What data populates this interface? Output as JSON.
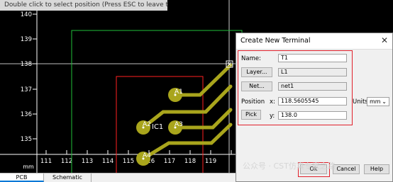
{
  "hint_text": "Double click to select position (Press ESC to leave this mode)",
  "y_ticks": [
    "140",
    "139",
    "138",
    "137",
    "136",
    "135"
  ],
  "x_ticks": [
    "111",
    "112",
    "113",
    "114",
    "115",
    "116",
    "117",
    "118",
    "119"
  ],
  "x_unit": "mm",
  "components": {
    "ic_label": "IC1",
    "pads": [
      {
        "label": "A1"
      },
      {
        "label": "A2"
      },
      {
        "label": "A3"
      },
      {
        "label": "A4"
      }
    ]
  },
  "tabs": [
    {
      "label": "PCB",
      "active": true
    },
    {
      "label": "Schematic",
      "active": false
    }
  ],
  "dialog": {
    "title": "Create New Terminal",
    "close_glyph": "✕",
    "name_label": "Name:",
    "name_value": "T1",
    "layer_button": "Layer...",
    "layer_value": "L1",
    "net_button": "Net...",
    "net_value": "net1",
    "position_label": "Position",
    "x_label": "x:",
    "x_value": "118.5605545",
    "units_label": "Units:",
    "units_value": "mm",
    "pick_button": "Pick",
    "y_label": "y:",
    "y_value": "138.0",
    "ok_button": "Ok",
    "cancel_button": "Cancel",
    "help_button": "Help"
  },
  "watermark": "公众号 · CST仿真专家之路",
  "colors": {
    "background": "#000000",
    "outline_green": "#1fbf3a",
    "outline_red": "#ff2020",
    "pads": "#a9a51c",
    "highlight_red": "#e0202a"
  }
}
